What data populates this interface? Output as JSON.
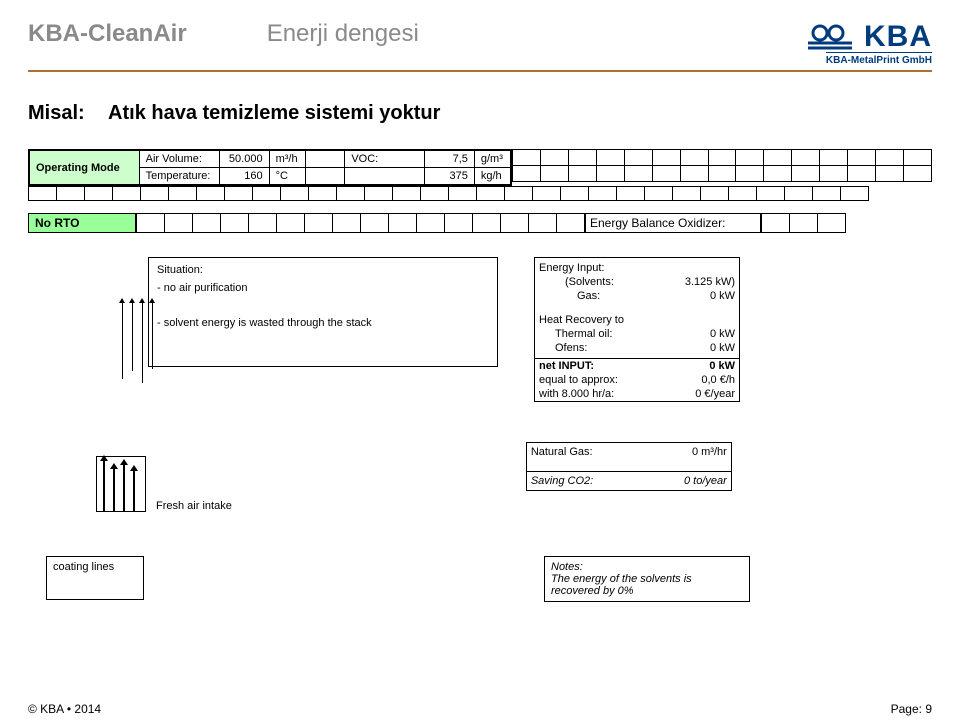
{
  "header": {
    "title_main": "KBA-CleanAir",
    "title_sub": "Enerji dengesi",
    "logo_text": "KBA",
    "logo_sub": "KBA-MetalPrint GmbH"
  },
  "subtitle": {
    "label": "Misal:",
    "text": "Atık hava temizleme sistemi yoktur"
  },
  "params": {
    "operating_mode": "Operating Mode",
    "air_volume_label": "Air Volume:",
    "air_volume_val": "50.000",
    "air_volume_unit": "m³/h",
    "temp_label": "Temperature:",
    "temp_val": "160",
    "temp_unit": "°C",
    "voc_label": "VOC:",
    "voc_val": "7,5",
    "voc_unit": "g/m³",
    "load_val": "375",
    "load_unit": "kg/h"
  },
  "no_rto": "No RTO",
  "energy_balance_label": "Energy Balance Oxidizer:",
  "situation": {
    "title": "Situation:",
    "line1": "- no air purification",
    "line2": "- solvent energy is wasted through the stack"
  },
  "energy_input": {
    "title": "Energy Input:",
    "solvents_label": "(Solvents:",
    "solvents_val": "3.125 kW)",
    "gas_label": "Gas:",
    "gas_val": "0 kW"
  },
  "heat_recovery": {
    "title": "Heat Recovery to",
    "thermal_label": "Thermal oil:",
    "thermal_val": "0 kW",
    "ofens_label": "Ofens:",
    "ofens_val": "0 kW"
  },
  "net_input": {
    "label": "net INPUT:",
    "val": "0 kW",
    "approx_label": "equal to approx:",
    "approx_val": "0,0 €/h",
    "with_label": "with 8.000 hr/a:",
    "with_val": "0 €/year"
  },
  "fresh_air": "Fresh air intake",
  "natural_gas": {
    "label": "Natural Gas:",
    "val": "0 m³/hr"
  },
  "saving_co2": {
    "label": "Saving CO2:",
    "val": "0 to/year"
  },
  "coating_lines": "coating lines",
  "notes": {
    "title": "Notes:",
    "text": "The energy of the solvents is recovered by 0%"
  },
  "footer": {
    "left": "© KBA • 2014",
    "right": "Page: 9"
  }
}
